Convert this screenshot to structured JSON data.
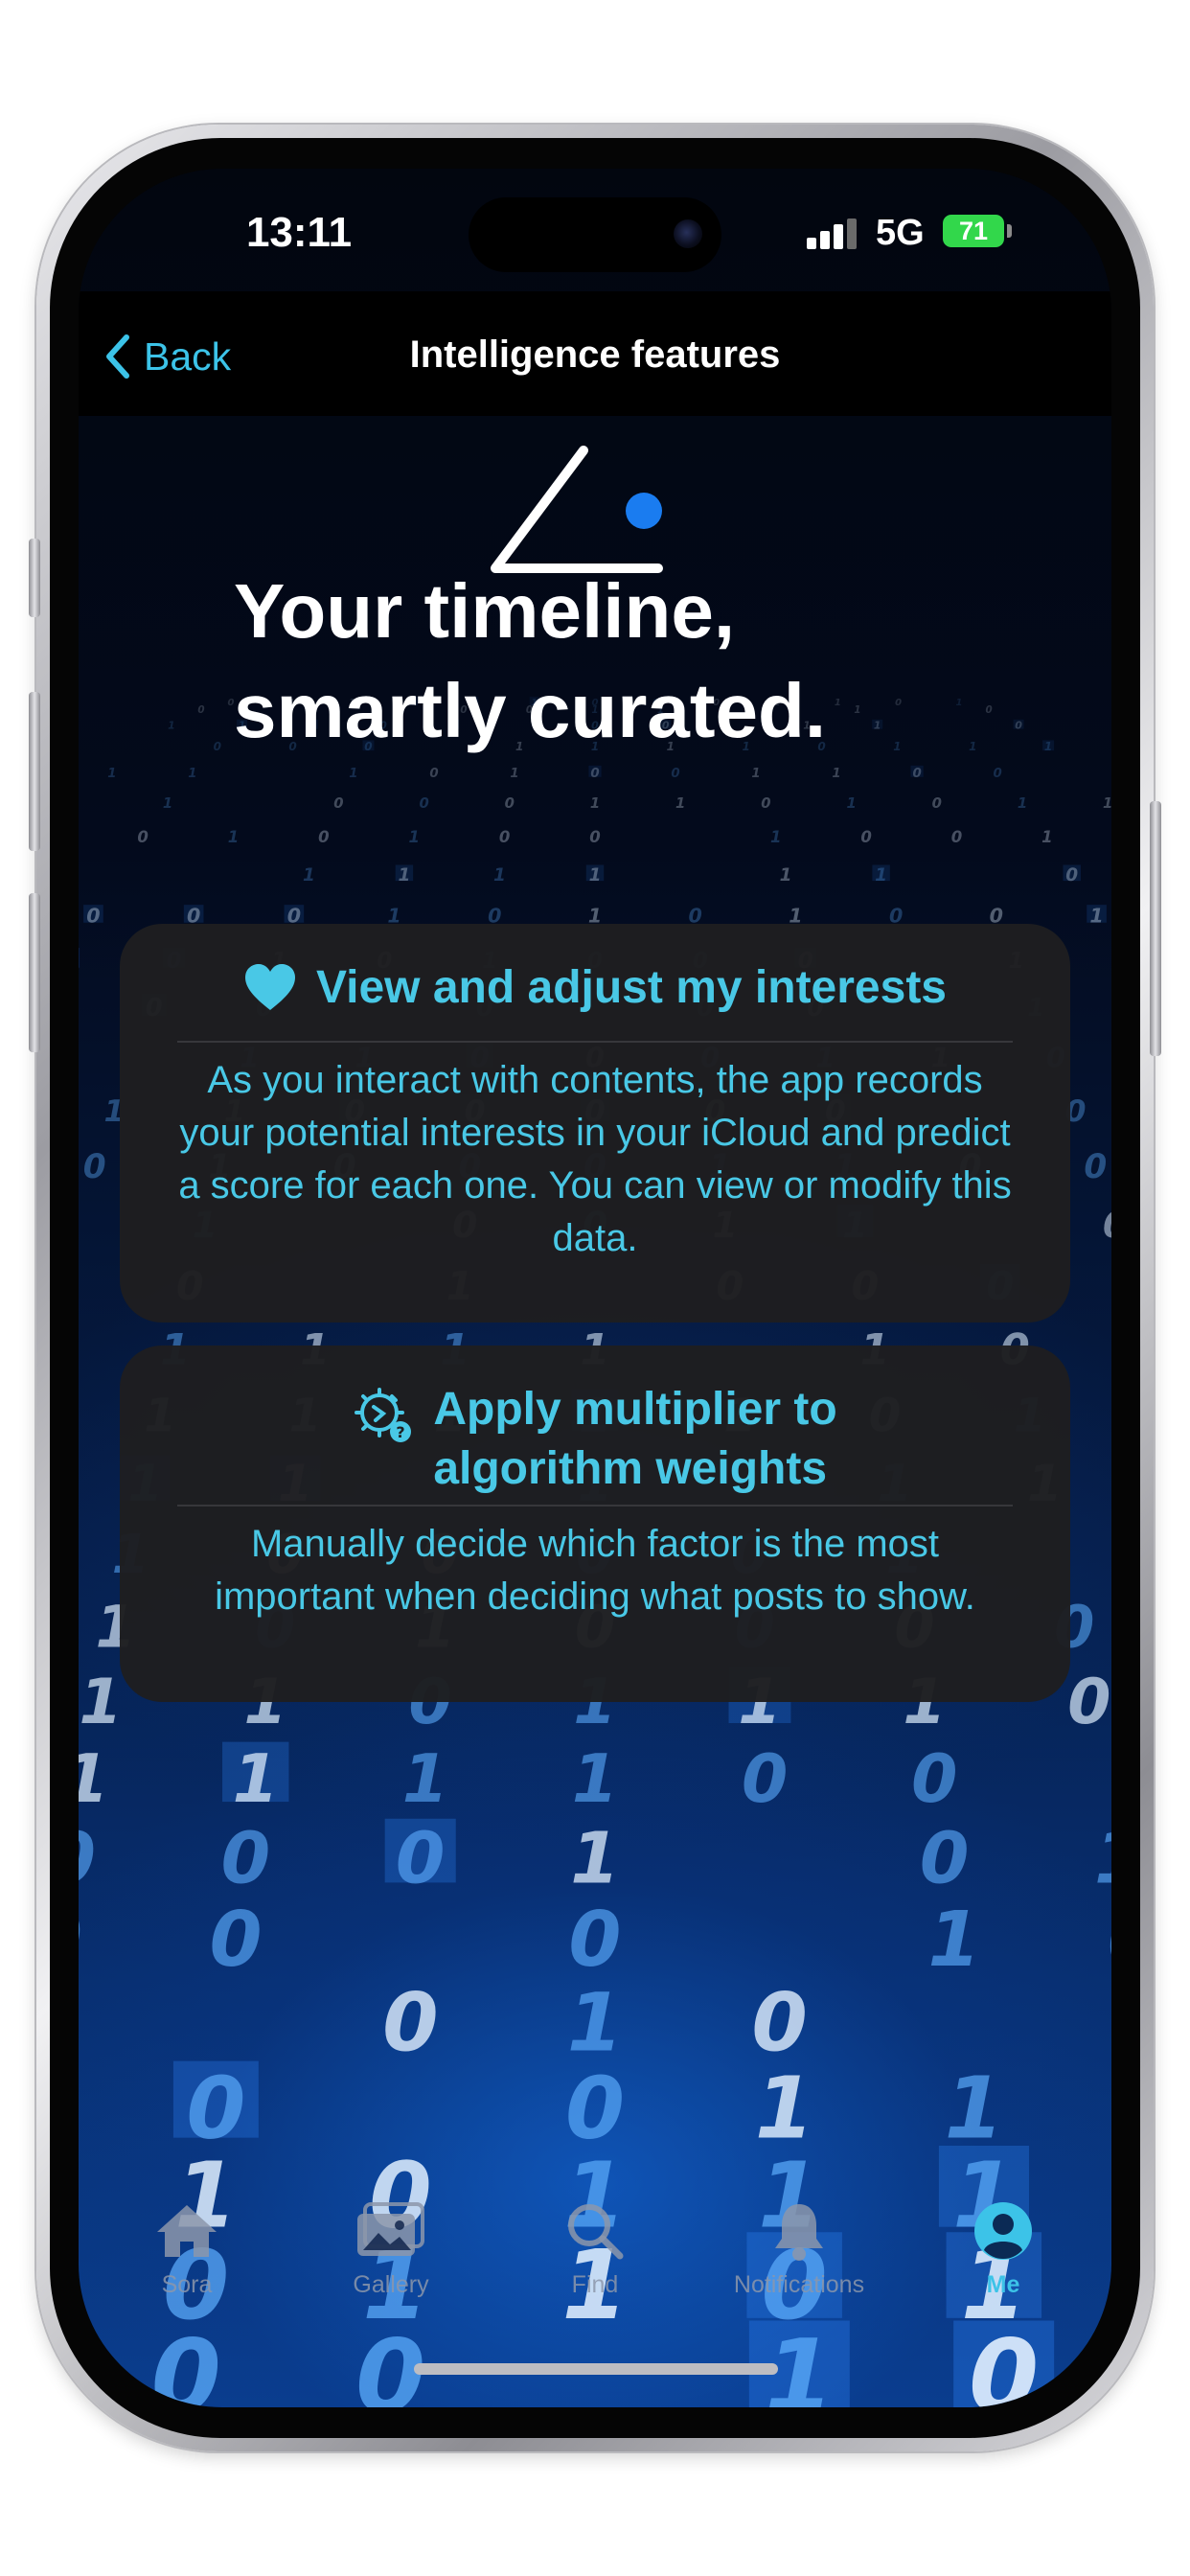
{
  "status_bar": {
    "time": "13:11",
    "network": "5G",
    "battery_percent": "71",
    "signal_bars_filled": 3,
    "signal_bars_total": 4
  },
  "nav": {
    "back_label": "Back",
    "title": "Intelligence features"
  },
  "hero": {
    "logo_icon": "angle-dot-logo",
    "headline_line1": "Your timeline,",
    "headline_line2": "smartly curated."
  },
  "cards": [
    {
      "icon": "heart-icon",
      "title": "View and adjust my interests",
      "description": "As you interact with contents, the app records your potential interests in your iCloud and predict a score for each one. You can view or modify this data."
    },
    {
      "icon": "gear-speedometer-icon",
      "title_line1": "Apply multiplier to",
      "title_line2": "algorithm weights",
      "description": "Manually decide which factor is the most important when deciding what posts to show."
    }
  ],
  "tab_bar": {
    "items": [
      {
        "label": "Sora",
        "icon": "house-icon"
      },
      {
        "label": "Gallery",
        "icon": "photos-icon"
      },
      {
        "label": "Find",
        "icon": "magnifier-icon"
      },
      {
        "label": "Notifications",
        "icon": "bell-icon"
      },
      {
        "label": "Me",
        "icon": "person-circle-icon"
      }
    ],
    "active_index": 4
  },
  "colors": {
    "accent": "#3cc3e8",
    "card_text": "#49c8e6",
    "logo_dot": "#1a7cf0",
    "card_background": "#1e1e20",
    "battery": "#32d74b"
  },
  "background_digits": "0 1"
}
